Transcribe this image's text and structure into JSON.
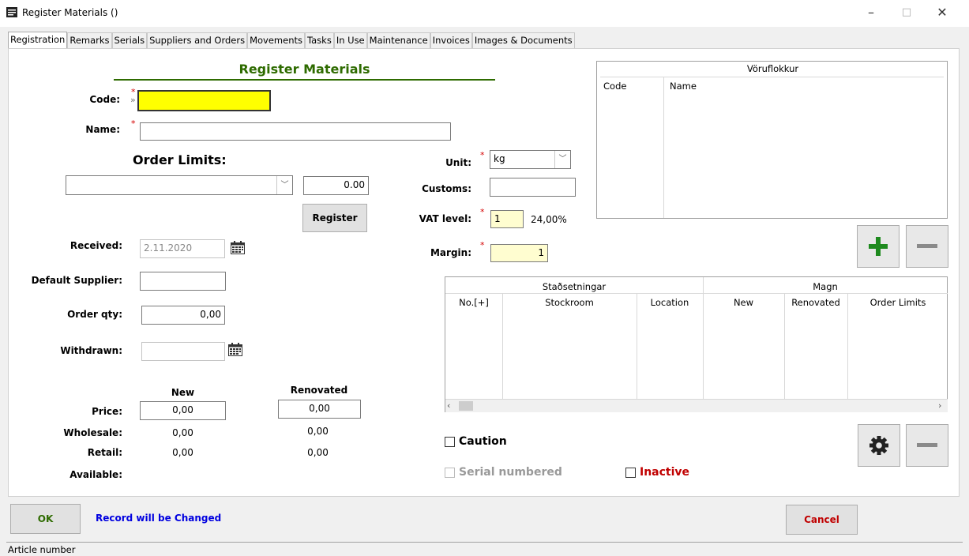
{
  "window": {
    "title": "Register Materials ()",
    "minimize": "–",
    "maximize": "□",
    "close": "✕"
  },
  "tabs": [
    "Registration",
    "Remarks",
    "Serials",
    "Suppliers and Orders",
    "Movements",
    "Tasks",
    "In Use",
    "Maintenance",
    "Invoices",
    "Images & Documents"
  ],
  "form": {
    "heading": "Register Materials",
    "code_label": "Code:",
    "code_value": "",
    "code_marker": "»",
    "name_label": "Name:",
    "name_value": "",
    "order_limits_heading": "Order Limits:",
    "order_limits_select": "",
    "order_limits_value": "0.00",
    "register_button": "Register",
    "received_label": "Received:",
    "received_value": "2.11.2020",
    "default_supplier_label": "Default Supplier:",
    "default_supplier_value": "",
    "order_qty_label": "Order qty:",
    "order_qty_value": "0,00",
    "withdrawn_label": "Withdrawn:",
    "withdrawn_value": "",
    "unit_label": "Unit:",
    "unit_value": "kg",
    "customs_label": "Customs:",
    "customs_value": "",
    "vat_label": "VAT level:",
    "vat_value": "1",
    "vat_percent": "24,00%",
    "margin_label": "Margin:",
    "margin_value": "1",
    "required_mark": "*"
  },
  "prices": {
    "new_header": "New",
    "renovated_header": "Renovated",
    "price_label": "Price:",
    "price_new": "0,00",
    "price_renovated": "0,00",
    "wholesale_label": "Wholesale:",
    "wholesale_new": "0,00",
    "wholesale_renovated": "0,00",
    "retail_label": "Retail:",
    "retail_new": "0,00",
    "retail_renovated": "0,00",
    "available_label": "Available:"
  },
  "category_grid": {
    "title": "Vöruflokkur",
    "columns": [
      "Code",
      "Name"
    ]
  },
  "location_grid": {
    "group_left": "Staðsetningar",
    "group_right": "Magn",
    "columns": [
      "No.[+]",
      "Stockroom",
      "Location",
      "New",
      "Renovated",
      "Order Limits"
    ]
  },
  "checkboxes": {
    "caution": "Caution",
    "serial_numbered": "Serial numbered",
    "inactive": "Inactive"
  },
  "footer": {
    "ok_button": "OK",
    "status_message": "Record will be Changed",
    "cancel_button": "Cancel",
    "status_bar": "Article number"
  },
  "colors": {
    "heading_green": "#2e6b00",
    "add_green": "#1e8a1e",
    "code_yellow": "#ffff00",
    "field_cream": "#fffdd0",
    "message_blue": "#0000e0",
    "cancel_red": "#c00000"
  }
}
